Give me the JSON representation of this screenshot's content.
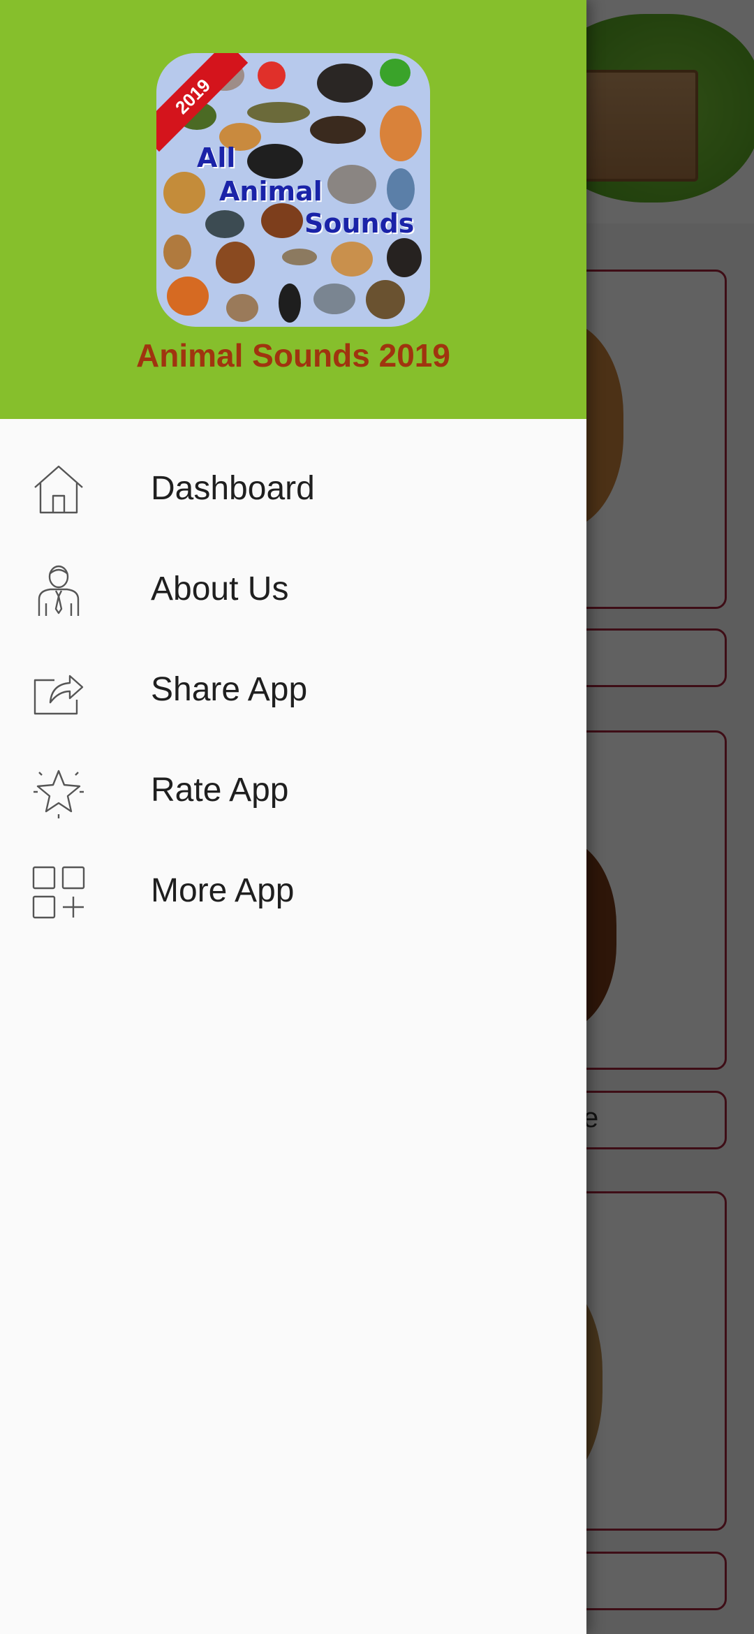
{
  "drawer": {
    "app_title": "Animal Sounds 2019",
    "logo": {
      "ribbon": "2019",
      "line1": "All",
      "line2": "Animal",
      "line3": "Sounds"
    },
    "menu_items": [
      {
        "label": "Dashboard",
        "icon": "home-icon"
      },
      {
        "label": "About Us",
        "icon": "person-icon"
      },
      {
        "label": "Share App",
        "icon": "share-icon"
      },
      {
        "label": "Rate App",
        "icon": "star-icon"
      },
      {
        "label": "More App",
        "icon": "apps-grid-icon"
      }
    ]
  },
  "background": {
    "partial_button_label": "e"
  },
  "colors": {
    "header_green": "#86bf2c",
    "title_brown": "#a0340f",
    "drawer_bg": "#fafafa",
    "card_border": "#a3223a"
  }
}
